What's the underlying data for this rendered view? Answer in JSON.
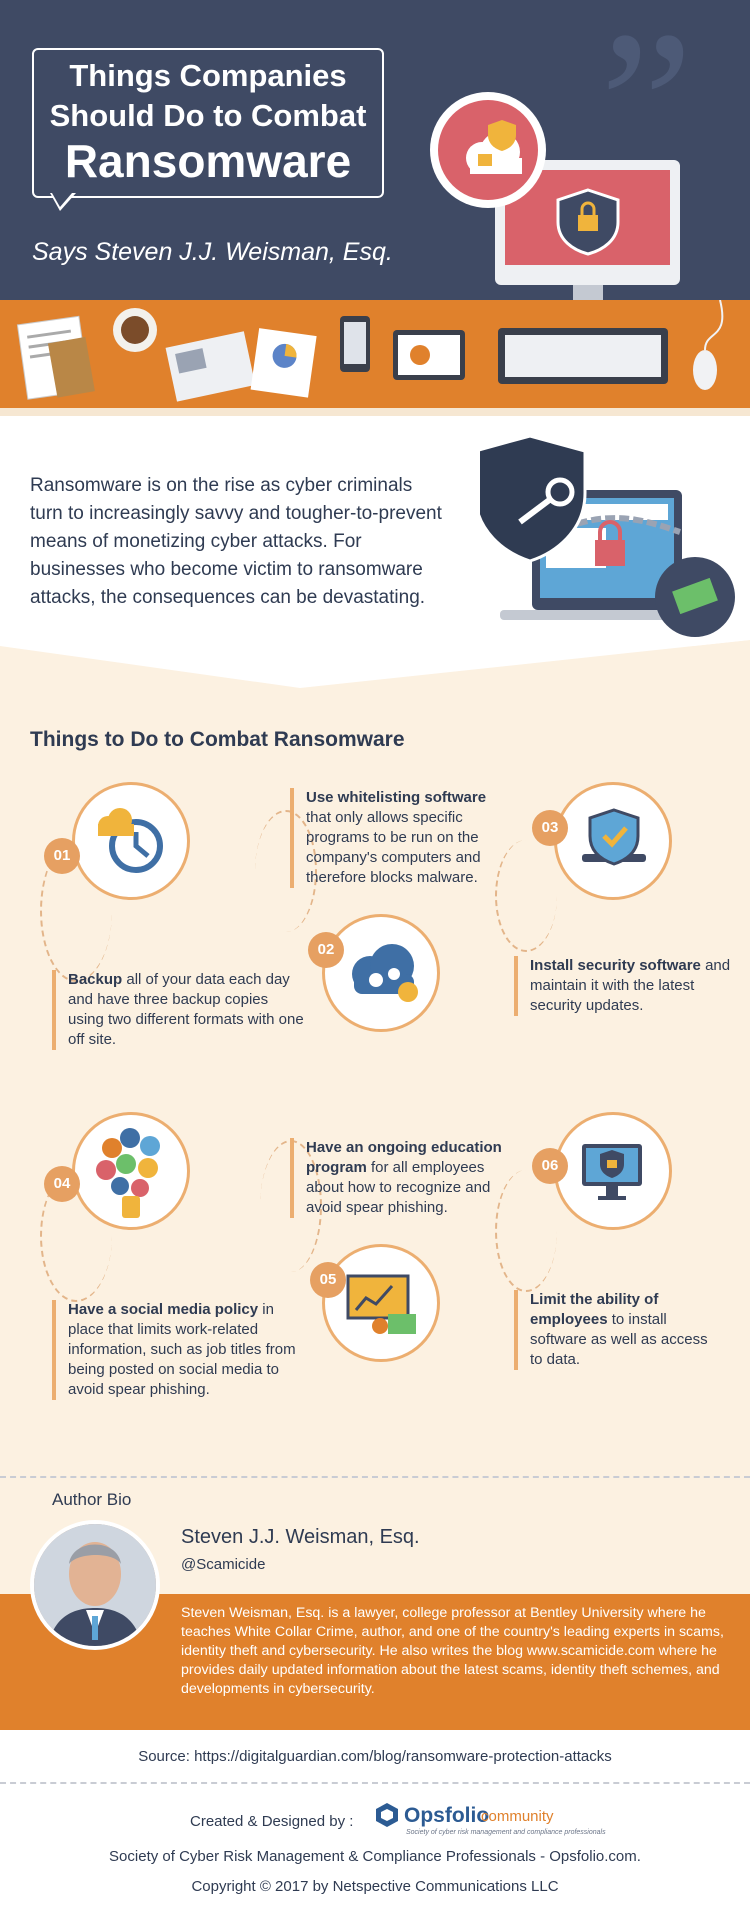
{
  "header": {
    "title_line1": "Things Companies",
    "title_line2": "Should Do to Combat",
    "title_line3": "Ransomware",
    "subtitle": "Says Steven J.J. Weisman, Esq."
  },
  "intro": {
    "text": "Ransomware is on the rise as cyber criminals turn to increasingly savvy and tougher-to-prevent means of monetizing cyber attacks. For businesses who become victim to ransomware attacks, the consequences can be devastating."
  },
  "section_title": "Things to Do to Combat Ransomware",
  "steps": [
    {
      "num": "01",
      "bold": "Backup",
      "rest": " all of your data each day and have three backup copies using two different formats with one off site."
    },
    {
      "num": "02",
      "bold": "Use whitelisting software",
      "rest": " that only allows specific programs to be run on the company's computers and therefore blocks malware."
    },
    {
      "num": "03",
      "bold": "Install security software",
      "rest": " and maintain it with the latest security updates."
    },
    {
      "num": "04",
      "bold": "Have a social media policy",
      "rest": " in place that limits work-related information, such as job titles from being posted on social media to avoid spear phishing."
    },
    {
      "num": "05",
      "bold": "Have an ongoing education program",
      "rest": " for all employees about how to recognize and avoid spear phishing."
    },
    {
      "num": "06",
      "bold": "Limit the ability of employees",
      "rest": " to install software as well as access to data."
    }
  ],
  "bio": {
    "heading": "Author Bio",
    "name": "Steven J.J. Weisman, Esq.",
    "handle": "@Scamicide",
    "text": "Steven Weisman, Esq. is a lawyer, college professor at Bentley University where he teaches White Collar Crime, author, and one of the country's leading experts in scams, identity theft and cybersecurity. He also writes the blog www.scamicide.com where he provides daily updated information about the latest scams, identity theft schemes, and developments in cybersecurity."
  },
  "footer": {
    "source": "Source: https://digitalguardian.com/blog/ransomware-protection-attacks",
    "created": "Created & Designed by :",
    "logo_main": "Opsfolio",
    "logo_sub": "community",
    "logo_tag": "Society of cyber risk management and compliance professionals",
    "society": "Society of Cyber Risk Management & Compliance Professionals - Opsfolio.com.",
    "copyright": "Copyright © 2017 by Netspective Communications LLC"
  },
  "colors": {
    "navy": "#3f4a64",
    "orange": "#e0812c",
    "cream": "#fcf1e1",
    "accent": "#ecae70"
  }
}
